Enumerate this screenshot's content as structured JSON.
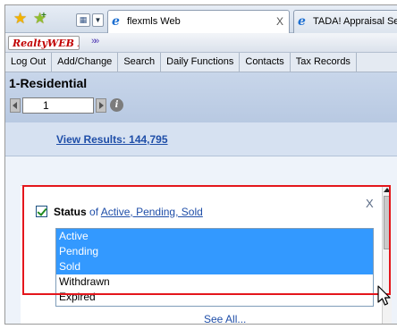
{
  "browser": {
    "tabs": [
      {
        "label": "flexmls Web",
        "active": true
      },
      {
        "label": "TADA! Appraisal Se",
        "active": false
      }
    ],
    "close_glyph": "X"
  },
  "realty_bar": {
    "logo_text": "RealtyWEB Net",
    "logo_mark": "®",
    "arrow_glyph": "»»"
  },
  "menu": {
    "items": [
      "Log Out",
      "Add/Change",
      "Search",
      "Daily Functions",
      "Contacts",
      "Tax Records"
    ]
  },
  "page": {
    "title": "1-Residential",
    "page_number": "1",
    "info_glyph": "i"
  },
  "results": {
    "link": "View Results: 144,795"
  },
  "filter": {
    "label": "Status",
    "of": "of",
    "values": "Active, Pending, Sold",
    "close_glyph": "X",
    "checked": true,
    "options": [
      {
        "label": "Active",
        "selected": true
      },
      {
        "label": "Pending",
        "selected": true
      },
      {
        "label": "Sold",
        "selected": true
      },
      {
        "label": "Withdrawn",
        "selected": false
      },
      {
        "label": "Expired",
        "selected": false
      }
    ],
    "see_all": "See All..."
  },
  "colors": {
    "selection": "#3399ff",
    "link": "#1f4ea8",
    "annotation": "#e4161c"
  }
}
